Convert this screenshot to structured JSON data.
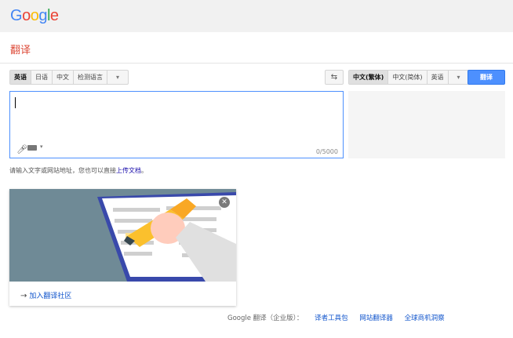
{
  "header": {
    "logo": [
      "G",
      "o",
      "o",
      "g",
      "l",
      "e"
    ],
    "logo_colors": [
      "#4285f4",
      "#ea4335",
      "#fbbc05",
      "#4285f4",
      "#34a853",
      "#ea4335"
    ],
    "title": "翻译"
  },
  "source_langs": {
    "options": [
      "英语",
      "日语",
      "中文",
      "检测语言"
    ],
    "active": "英语"
  },
  "target_langs": {
    "options": [
      "中文(繁体)",
      "中文(简体)",
      "英语"
    ],
    "active": "中文(繁体)"
  },
  "toolbar": {
    "swap_icon": "swap-icon",
    "translate_label": "翻译"
  },
  "input": {
    "value": "",
    "counter": "0/5000"
  },
  "hint": {
    "text": "请输入文字或网站地址，您也可以直接",
    "link": "上传文档",
    "end": "。"
  },
  "card": {
    "link_label": "加入翻译社区"
  },
  "footer": {
    "brand": "Google 翻译（企业版）：",
    "links": [
      "译者工具包",
      "网站翻译器",
      "全球商机洞察"
    ]
  }
}
